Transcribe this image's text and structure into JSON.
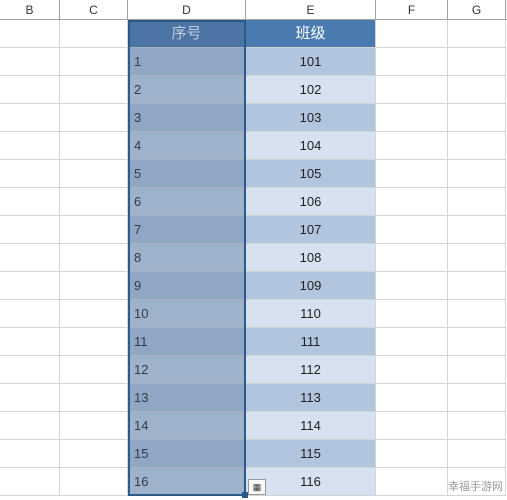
{
  "columns": {
    "B": "B",
    "C": "C",
    "D": "D",
    "E": "E",
    "F": "F",
    "G": "G"
  },
  "table": {
    "header_d": "序号",
    "header_e": "班级",
    "rows": [
      {
        "seq": "1",
        "class": "101"
      },
      {
        "seq": "2",
        "class": "102"
      },
      {
        "seq": "3",
        "class": "103"
      },
      {
        "seq": "4",
        "class": "104"
      },
      {
        "seq": "5",
        "class": "105"
      },
      {
        "seq": "6",
        "class": "106"
      },
      {
        "seq": "7",
        "class": "107"
      },
      {
        "seq": "8",
        "class": "108"
      },
      {
        "seq": "9",
        "class": "109"
      },
      {
        "seq": "10",
        "class": "110"
      },
      {
        "seq": "11",
        "class": "111"
      },
      {
        "seq": "12",
        "class": "112"
      },
      {
        "seq": "13",
        "class": "113"
      },
      {
        "seq": "14",
        "class": "114"
      },
      {
        "seq": "15",
        "class": "115"
      },
      {
        "seq": "16",
        "class": "116"
      }
    ]
  },
  "autofill_icon": "▦",
  "watermark": "幸福手游网"
}
